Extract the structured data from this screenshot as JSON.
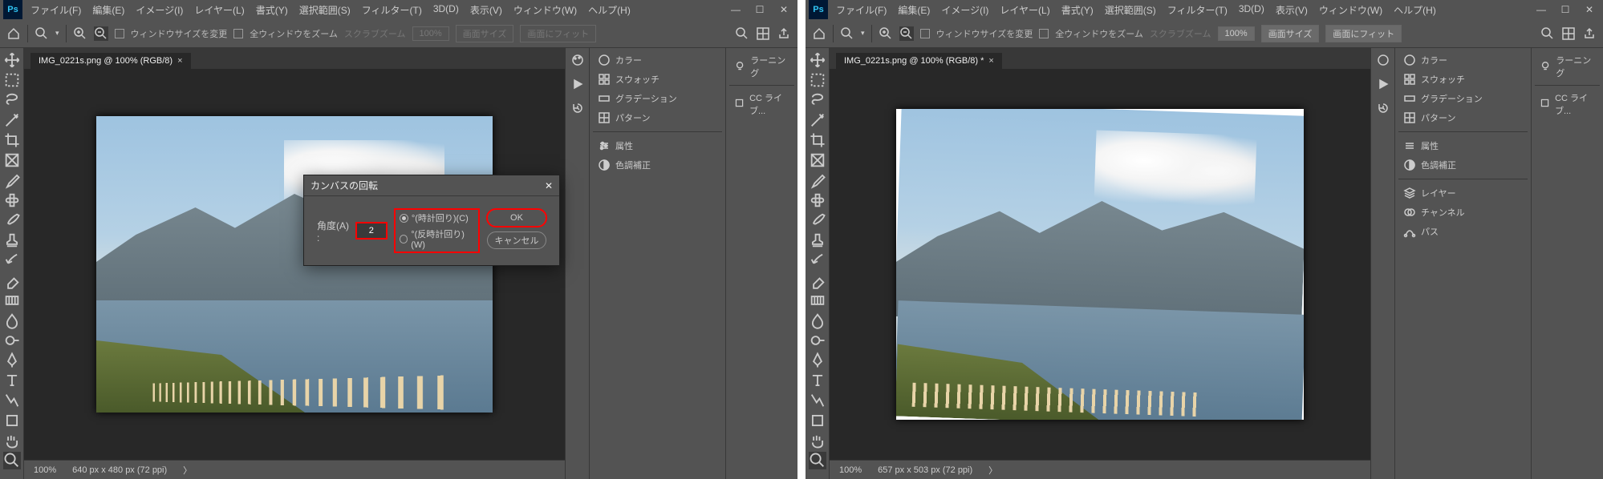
{
  "menu": [
    "ファイル(F)",
    "編集(E)",
    "イメージ(I)",
    "レイヤー(L)",
    "書式(Y)",
    "選択範囲(S)",
    "フィルター(T)",
    "3D(D)",
    "表示(V)",
    "ウィンドウ(W)",
    "ヘルプ(H)"
  ],
  "opt": {
    "resize": "ウィンドウサイズを変更",
    "allwin": "全ウィンドウをズーム",
    "scrub": "スクラブズーム",
    "pct": "100%",
    "fit": "画面サイズ",
    "fitwin": "画面にフィット"
  },
  "left": {
    "tab": "IMG_0221s.png @ 100% (RGB/8)",
    "zoom": "100%",
    "dim": "640 px x 480 px (72 ppi)"
  },
  "right": {
    "tab": "IMG_0221s.png @ 100% (RGB/8) *",
    "zoom": "100%",
    "dim": "657 px x 503 px (72 ppi)"
  },
  "panels": [
    "カラー",
    "スウォッチ",
    "グラデーション",
    "パターン",
    "属性",
    "色調補正"
  ],
  "panels_extra": [
    "レイヤー",
    "チャンネル",
    "パス"
  ],
  "learn": {
    "learning": "ラーニング",
    "cclib": "CC ライブ..."
  },
  "dialog": {
    "title": "カンバスの回転",
    "angle_label": "角度(A) :",
    "angle_value": "2",
    "cw": "°(時計回り)(C)",
    "ccw": "°(反時計回り)(W)",
    "ok": "OK",
    "cancel": "キャンセル"
  }
}
